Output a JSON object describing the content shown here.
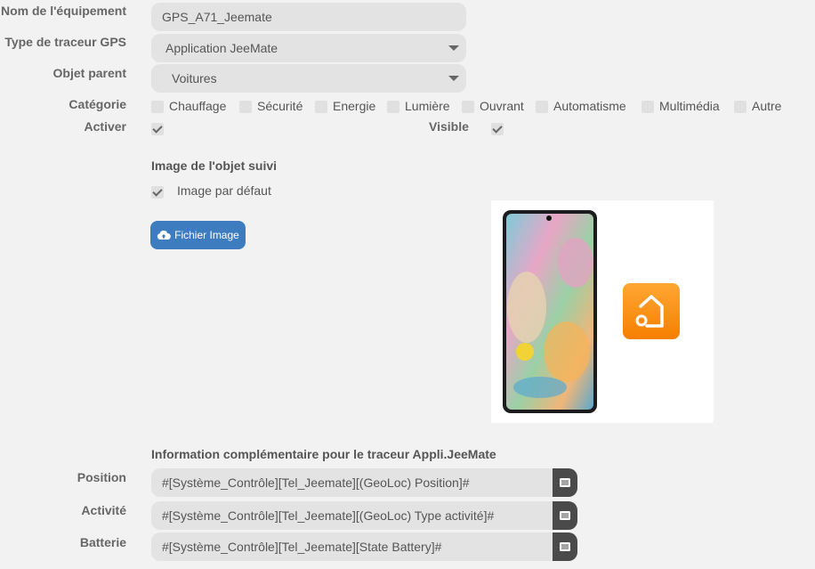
{
  "form": {
    "name_label": "Nom de l'équipement",
    "name_value": "GPS_A71_Jeemate",
    "tracker_type_label": "Type de traceur GPS",
    "tracker_type_value": "Application JeeMate",
    "parent_label": "Objet parent",
    "parent_value": "Voitures",
    "category_label": "Catégorie",
    "categories": [
      {
        "label": "Chauffage",
        "checked": false
      },
      {
        "label": "Sécurité",
        "checked": false
      },
      {
        "label": "Energie",
        "checked": false
      },
      {
        "label": "Lumière",
        "checked": false
      },
      {
        "label": "Ouvrant",
        "checked": false
      },
      {
        "label": "Automatisme",
        "checked": false
      },
      {
        "label": "Multimédia",
        "checked": false
      },
      {
        "label": "Autre",
        "checked": false
      }
    ],
    "activate_label": "Activer",
    "activate_checked": true,
    "visible_label": "Visible",
    "visible_checked": true
  },
  "image_section": {
    "title": "Image de l'objet suivi",
    "default_image_label": "Image par défaut",
    "default_image_checked": true,
    "upload_button_label": "Fichier Image",
    "upload_icon": "cloud-upload-icon"
  },
  "info_section": {
    "title": "Information complémentaire pour le traceur Appli.JeeMate",
    "position_label": "Position",
    "position_value": "#[Système_Contrôle][Tel_Jeemate][(GeoLoc) Position]#",
    "activity_label": "Activité",
    "activity_value": "#[Système_Contrôle][Tel_Jeemate][(GeoLoc) Type activité]#",
    "battery_label": "Batterie",
    "battery_value": "#[Système_Contrôle][Tel_Jeemate][State Battery]#",
    "select_cmd_icon": "list-icon"
  },
  "colors": {
    "button_blue": "#3e7cc0",
    "jeemate_orange": "#f7941d",
    "field_bg": "#e3e3e3",
    "cmd_button_bg": "#4a4a4a"
  }
}
